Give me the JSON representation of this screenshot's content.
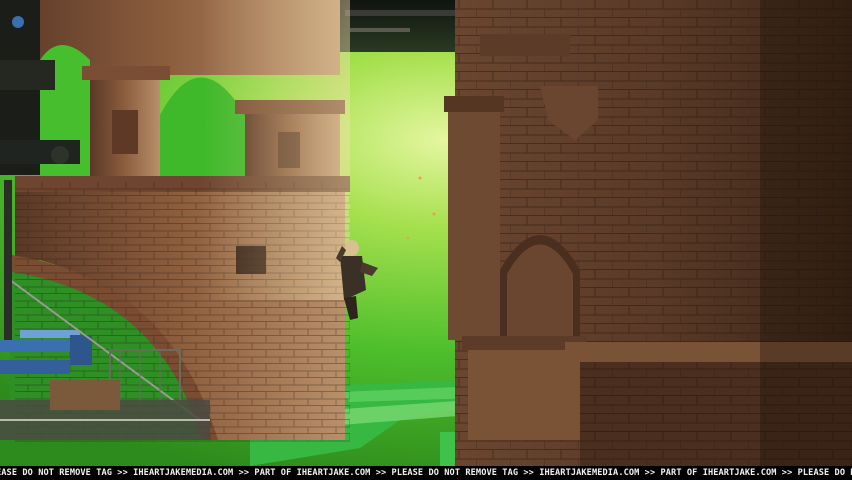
{
  "image": {
    "subject": "film-set-photo",
    "palette": {
      "greenscreen": "#49c12a",
      "greenscreen_glow": "#d8f28a",
      "stone": "#8a5a3a",
      "stone_dark": "#4a2e1e",
      "floor_green": "#2fa83a",
      "crane_blue": "#3a6fb0"
    }
  },
  "watermark": {
    "text": "EASE DO NOT REMOVE TAG >> IHEARTJAKEMEDIA.COM >> PART OF IHEARTJAKE.COM >> PLEASE DO NOT REMOVE TAG >> IHEARTJAKEMEDIA.COM >> PART OF IHEARTJAKE.COM >> PLEASE DO NOT REMOVE TAG >> IHEARTJAKE"
  }
}
